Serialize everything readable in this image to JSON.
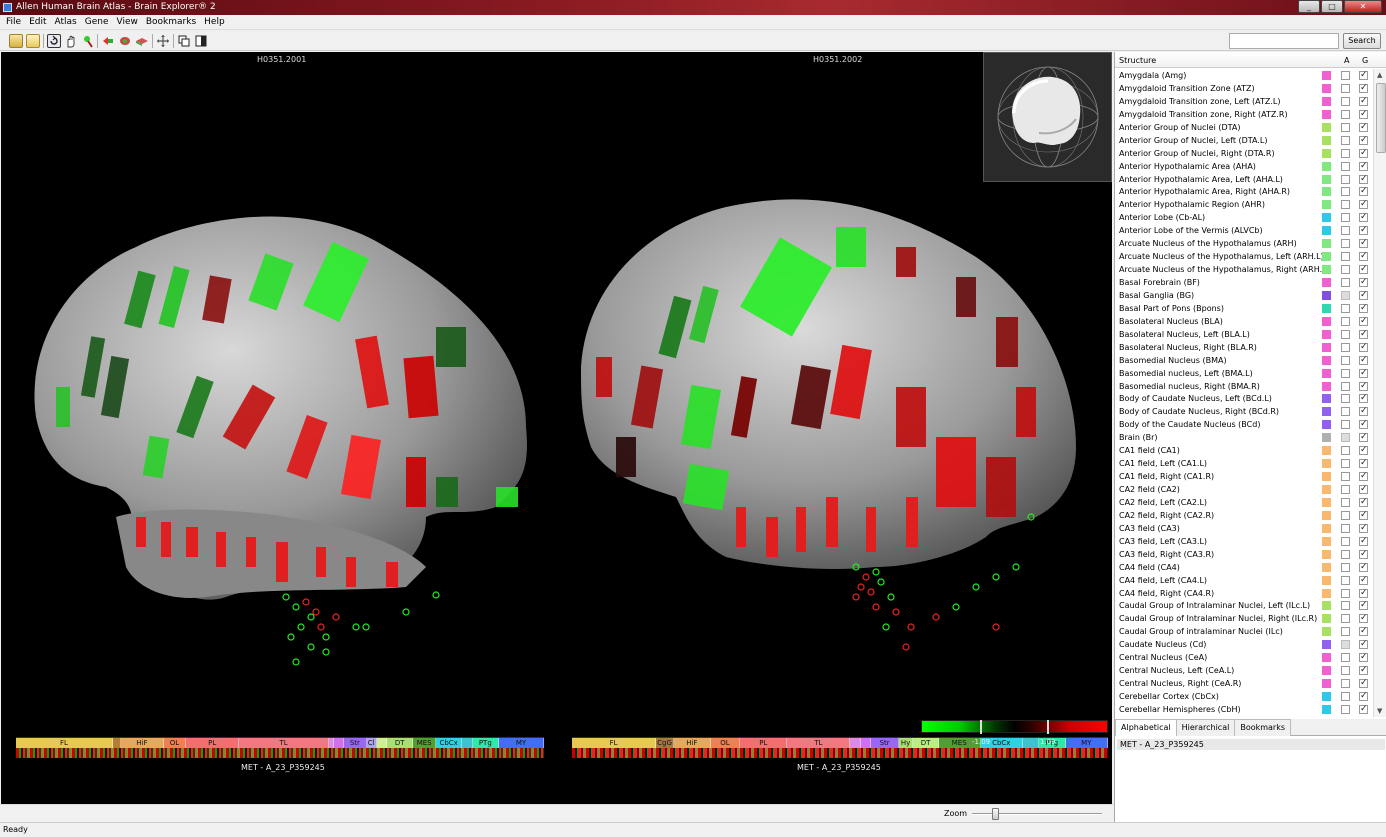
{
  "window": {
    "title": "Allen Human Brain Atlas - Brain Explorer® 2",
    "min": "_",
    "max": "□",
    "close": "✕"
  },
  "menu": [
    "File",
    "Edit",
    "Atlas",
    "Gene",
    "View",
    "Bookmarks",
    "Help"
  ],
  "toolbar": {
    "icons": [
      "open-folder-icon",
      "folder-icon",
      "rotate-icon",
      "pan-hand-icon",
      "pick-icon",
      "red-arrow-icon",
      "green-brain-icon",
      "flat-brain-icon",
      "move-icon",
      "copy-icon",
      "split-view-icon"
    ],
    "search_placeholder": "",
    "search_label": "Search"
  },
  "views": [
    {
      "title": "H0351.2001",
      "gene": "MET - A_23_P359245",
      "regions": [
        "FL",
        "",
        "HiF",
        "OL",
        "PL",
        "TL",
        "",
        "",
        "Str",
        "Cl",
        "",
        "DT",
        "MES",
        "CbCx",
        "",
        "PTg",
        "MY"
      ],
      "colors": [
        "#e8c855",
        "#b87e30",
        "#e8a85a",
        "#f08050",
        "#f07070",
        "#f07880",
        "#e088e8",
        "#d070f0",
        "#9a68f0",
        "#b0a0f0",
        "#d0f090",
        "#a8e070",
        "#4fa030",
        "#30d0e8",
        "#40c0d0",
        "#30e8a8",
        "#4070f0"
      ]
    },
    {
      "title": "H0351.2002",
      "gene": "MET - A_23_P359245",
      "regions": [
        "FL",
        "CgG",
        "HiF",
        "OL",
        "PL",
        "TL",
        "",
        "",
        "Str",
        "Hy",
        "DT",
        "MES",
        "CbCx",
        "",
        "PTg",
        "MY"
      ],
      "colors": [
        "#e8c855",
        "#a87a40",
        "#e8a85a",
        "#f08050",
        "#f07070",
        "#f07880",
        "#e088e8",
        "#d070f0",
        "#9a68f0",
        "#a8e070",
        "#b8f080",
        "#4fa030",
        "#30d0e8",
        "#40c0d0",
        "#30e8a8",
        "#4070f0"
      ]
    }
  ],
  "scale": {
    "min": "-1.09",
    "max": "1.09"
  },
  "zoom": {
    "label": "Zoom",
    "value": 0.18
  },
  "status": "Ready",
  "panel": {
    "columns": {
      "structure": "Structure",
      "a": "A",
      "g": "G"
    },
    "structures": [
      {
        "name": "Amygdala (Amg)",
        "color": "#f060d0"
      },
      {
        "name": "Amygdaloid Transition Zone (ATZ)",
        "color": "#f060d0"
      },
      {
        "name": "Amygdaloid Transition zone, Left (ATZ.L)",
        "color": "#f060d0"
      },
      {
        "name": "Amygdaloid Transition zone, Right (ATZ.R)",
        "color": "#f060d0"
      },
      {
        "name": "Anterior Group of Nuclei (DTA)",
        "color": "#a8e060"
      },
      {
        "name": "Anterior Group of Nuclei, Left (DTA.L)",
        "color": "#a8e060"
      },
      {
        "name": "Anterior Group of Nuclei, Right (DTA.R)",
        "color": "#a8e060"
      },
      {
        "name": "Anterior Hypothalamic Area (AHA)",
        "color": "#80e880"
      },
      {
        "name": "Anterior Hypothalamic Area, Left (AHA.L)",
        "color": "#80e880"
      },
      {
        "name": "Anterior Hypothalamic Area, Right (AHA.R)",
        "color": "#80e880"
      },
      {
        "name": "Anterior Hypothalamic Region (AHR)",
        "color": "#80e880"
      },
      {
        "name": "Anterior Lobe (Cb-AL)",
        "color": "#30c8e8"
      },
      {
        "name": "Anterior Lobe of the Vermis (ALVCb)",
        "color": "#30c8e8"
      },
      {
        "name": "Arcuate Nucleus of the Hypothalamus (ARH)",
        "color": "#80e880"
      },
      {
        "name": "Arcuate Nucleus of the Hypothalamus, Left (ARH.L)",
        "color": "#80e880"
      },
      {
        "name": "Arcuate Nucleus of the Hypothalamus, Right (ARH.R)",
        "color": "#80e880"
      },
      {
        "name": "Basal Forebrain (BF)",
        "color": "#f060d0"
      },
      {
        "name": "Basal Ganglia (BG)",
        "color": "#8050e0"
      },
      {
        "name": "Basal Part of Pons (Bpons)",
        "color": "#30d8b0"
      },
      {
        "name": "Basolateral Nucleus (BLA)",
        "color": "#f060d0"
      },
      {
        "name": "Basolateral Nucleus, Left (BLA.L)",
        "color": "#f060d0"
      },
      {
        "name": "Basolateral Nucleus, Right (BLA.R)",
        "color": "#f060d0"
      },
      {
        "name": "Basomedial Nucleus (BMA)",
        "color": "#f060d0"
      },
      {
        "name": "Basomedial nucleus, Left (BMA.L)",
        "color": "#f060d0"
      },
      {
        "name": "Basomedial nucleus, Right (BMA.R)",
        "color": "#f060d0"
      },
      {
        "name": "Body of Caudate Nucleus, Left (BCd.L)",
        "color": "#9060f0"
      },
      {
        "name": "Body of Caudate Nucleus, Right (BCd.R)",
        "color": "#9060f0"
      },
      {
        "name": "Body of the Caudate Nucleus (BCd)",
        "color": "#9060f0"
      },
      {
        "name": "Brain (Br)",
        "color": "#b0b0b0"
      },
      {
        "name": "CA1 field (CA1)",
        "color": "#f8b870"
      },
      {
        "name": "CA1 field, Left (CA1.L)",
        "color": "#f8b870"
      },
      {
        "name": "CA1 field, Right (CA1.R)",
        "color": "#f8b870"
      },
      {
        "name": "CA2 field (CA2)",
        "color": "#f8b870"
      },
      {
        "name": "CA2 field, Left (CA2.L)",
        "color": "#f8b870"
      },
      {
        "name": "CA2 field, Right (CA2.R)",
        "color": "#f8b870"
      },
      {
        "name": "CA3 field (CA3)",
        "color": "#f8b870"
      },
      {
        "name": "CA3 field, Left (CA3.L)",
        "color": "#f8b870"
      },
      {
        "name": "CA3 field, Right (CA3.R)",
        "color": "#f8b870"
      },
      {
        "name": "CA4 field (CA4)",
        "color": "#f8b870"
      },
      {
        "name": "CA4 field, Left (CA4.L)",
        "color": "#f8b870"
      },
      {
        "name": "CA4 field, Right (CA4.R)",
        "color": "#f8b870"
      },
      {
        "name": "Caudal Group of Intralaminar Nuclei, Left (ILc.L)",
        "color": "#a8e060"
      },
      {
        "name": "Caudal Group of Intralaminar Nuclei, Right (ILc.R)",
        "color": "#a8e060"
      },
      {
        "name": "Caudal Group of intralaminar Nuclei (ILc)",
        "color": "#a8e060"
      },
      {
        "name": "Caudate Nucleus (Cd)",
        "color": "#9060f0"
      },
      {
        "name": "Central Nucleus (CeA)",
        "color": "#f060d0"
      },
      {
        "name": "Central Nucleus, Left (CeA.L)",
        "color": "#f060d0"
      },
      {
        "name": "Central Nucleus, Right (CeA.R)",
        "color": "#f060d0"
      },
      {
        "name": "Cerebellar Cortex (CbCx)",
        "color": "#30c8e8"
      },
      {
        "name": "Cerebellar Hemispheres (CbH)",
        "color": "#30c8e8"
      }
    ],
    "tabs": [
      "Alphabetical",
      "Hierarchical",
      "Bookmarks"
    ],
    "genes": [
      "MET - A_23_P359245"
    ]
  }
}
